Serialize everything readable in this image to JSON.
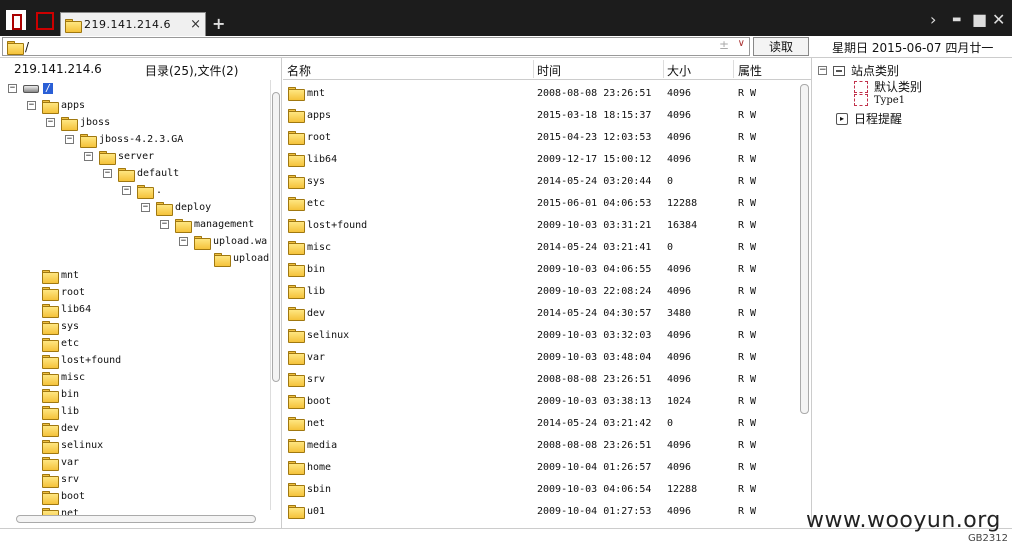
{
  "tab": {
    "label": "219.141.214.6",
    "close": "×",
    "add": "+"
  },
  "window_controls": {
    "next": "›",
    "minimize": "▬",
    "maximize": "■",
    "close": "✕"
  },
  "address": {
    "path": "/",
    "plus": "±",
    "dropdown": "∨",
    "read_button": "读取",
    "date": "星期日 2015-06-07 四月廿一"
  },
  "tree_header": {
    "host": "219.141.214.6",
    "counts": "目录(25),文件(2)"
  },
  "tree": [
    {
      "label": "/",
      "depth": 0,
      "expander": "−",
      "type": "root"
    },
    {
      "label": "apps",
      "depth": 1,
      "expander": "−"
    },
    {
      "label": "jboss",
      "depth": 2,
      "expander": "−"
    },
    {
      "label": "jboss-4.2.3.GA",
      "depth": 3,
      "expander": "−"
    },
    {
      "label": "server",
      "depth": 4,
      "expander": "−"
    },
    {
      "label": "default",
      "depth": 5,
      "expander": "−"
    },
    {
      "label": ".",
      "depth": 6,
      "expander": "−"
    },
    {
      "label": "deploy",
      "depth": 7,
      "expander": "−"
    },
    {
      "label": "management",
      "depth": 8,
      "expander": "−"
    },
    {
      "label": "upload.wa",
      "depth": 9,
      "expander": "−"
    },
    {
      "label": "upload",
      "depth": 10,
      "expander": ""
    },
    {
      "label": "mnt",
      "depth": 1,
      "expander": ""
    },
    {
      "label": "root",
      "depth": 1,
      "expander": ""
    },
    {
      "label": "lib64",
      "depth": 1,
      "expander": ""
    },
    {
      "label": "sys",
      "depth": 1,
      "expander": ""
    },
    {
      "label": "etc",
      "depth": 1,
      "expander": ""
    },
    {
      "label": "lost+found",
      "depth": 1,
      "expander": ""
    },
    {
      "label": "misc",
      "depth": 1,
      "expander": ""
    },
    {
      "label": "bin",
      "depth": 1,
      "expander": ""
    },
    {
      "label": "lib",
      "depth": 1,
      "expander": ""
    },
    {
      "label": "dev",
      "depth": 1,
      "expander": ""
    },
    {
      "label": "selinux",
      "depth": 1,
      "expander": ""
    },
    {
      "label": "var",
      "depth": 1,
      "expander": ""
    },
    {
      "label": "srv",
      "depth": 1,
      "expander": ""
    },
    {
      "label": "boot",
      "depth": 1,
      "expander": ""
    },
    {
      "label": "net",
      "depth": 1,
      "expander": ""
    }
  ],
  "file_columns": {
    "name": "名称",
    "time": "时间",
    "size": "大小",
    "attr": "属性"
  },
  "files": [
    {
      "name": "mnt",
      "time": "2008-08-08 23:26:51",
      "size": "4096",
      "attr": "R W"
    },
    {
      "name": "apps",
      "time": "2015-03-18 18:15:37",
      "size": "4096",
      "attr": "R W"
    },
    {
      "name": "root",
      "time": "2015-04-23 12:03:53",
      "size": "4096",
      "attr": "R W"
    },
    {
      "name": "lib64",
      "time": "2009-12-17 15:00:12",
      "size": "4096",
      "attr": "R W"
    },
    {
      "name": "sys",
      "time": "2014-05-24 03:20:44",
      "size": "0",
      "attr": "R W"
    },
    {
      "name": "etc",
      "time": "2015-06-01 04:06:53",
      "size": "12288",
      "attr": "R W"
    },
    {
      "name": "lost+found",
      "time": "2009-10-03 03:31:21",
      "size": "16384",
      "attr": "R W"
    },
    {
      "name": "misc",
      "time": "2014-05-24 03:21:41",
      "size": "0",
      "attr": "R W"
    },
    {
      "name": "bin",
      "time": "2009-10-03 04:06:55",
      "size": "4096",
      "attr": "R W"
    },
    {
      "name": "lib",
      "time": "2009-10-03 22:08:24",
      "size": "4096",
      "attr": "R W"
    },
    {
      "name": "dev",
      "time": "2014-05-24 04:30:57",
      "size": "3480",
      "attr": "R W"
    },
    {
      "name": "selinux",
      "time": "2009-10-03 03:32:03",
      "size": "4096",
      "attr": "R W"
    },
    {
      "name": "var",
      "time": "2009-10-03 03:48:04",
      "size": "4096",
      "attr": "R W"
    },
    {
      "name": "srv",
      "time": "2008-08-08 23:26:51",
      "size": "4096",
      "attr": "R W"
    },
    {
      "name": "boot",
      "time": "2009-10-03 03:38:13",
      "size": "1024",
      "attr": "R W"
    },
    {
      "name": "net",
      "time": "2014-05-24 03:21:42",
      "size": "0",
      "attr": "R W"
    },
    {
      "name": "media",
      "time": "2008-08-08 23:26:51",
      "size": "4096",
      "attr": "R W"
    },
    {
      "name": "home",
      "time": "2009-10-04 01:26:57",
      "size": "4096",
      "attr": "R W"
    },
    {
      "name": "sbin",
      "time": "2009-10-03 04:06:54",
      "size": "12288",
      "attr": "R W"
    },
    {
      "name": "u01",
      "time": "2009-10-04 01:27:53",
      "size": "4096",
      "attr": "R W"
    }
  ],
  "categories": {
    "root_label": "站点类别",
    "items": [
      "默认类别",
      "Type1"
    ],
    "schedule_label": "日程提醒"
  },
  "status": {
    "encoding": "GB2312",
    "watermark": "www.wooyun.org"
  }
}
